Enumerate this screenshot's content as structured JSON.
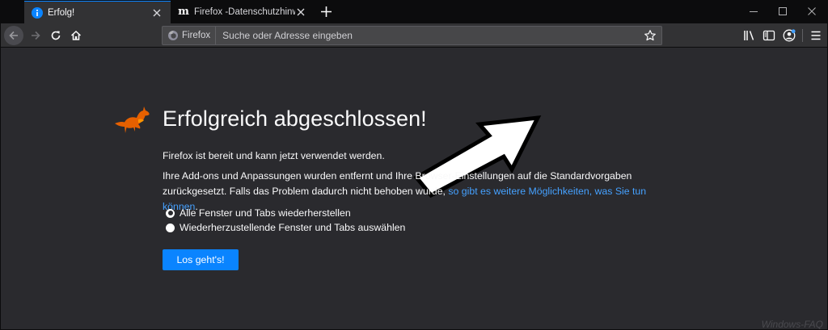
{
  "tabs": [
    {
      "title": "Erfolg!",
      "active": true,
      "favicon": "info-icon"
    },
    {
      "title": "Firefox -Datenschutzhinweis —",
      "active": false,
      "favicon": "m"
    }
  ],
  "urlbar": {
    "identity_label": "Firefox",
    "placeholder": "Suche oder Adresse eingeben",
    "value": ""
  },
  "page": {
    "heading": "Erfolgreich abgeschlossen!",
    "ready_text": "Firefox ist bereit und kann jetzt verwendet werden.",
    "reset_text": "Ihre Add-ons und Anpassungen wurden entfernt und Ihre Browser-Einstellungen auf die Standardvorgaben zurückgesetzt. Falls das Problem dadurch nicht behoben wurde,",
    "link_text": "so gibt es weitere Möglichkeiten, was Sie tun können",
    "period": ".",
    "options": [
      {
        "label": "Alle Fenster und Tabs wiederherstellen",
        "checked": true
      },
      {
        "label": "Wiederherzustellende Fenster und Tabs auswählen",
        "checked": false
      }
    ],
    "button": "Los geht's!"
  },
  "watermark": "Windows-FAQ",
  "colors": {
    "accent": "#0a84ff",
    "link": "#45a1ff",
    "fox": "#e66000",
    "background": "#2a2a2e"
  }
}
